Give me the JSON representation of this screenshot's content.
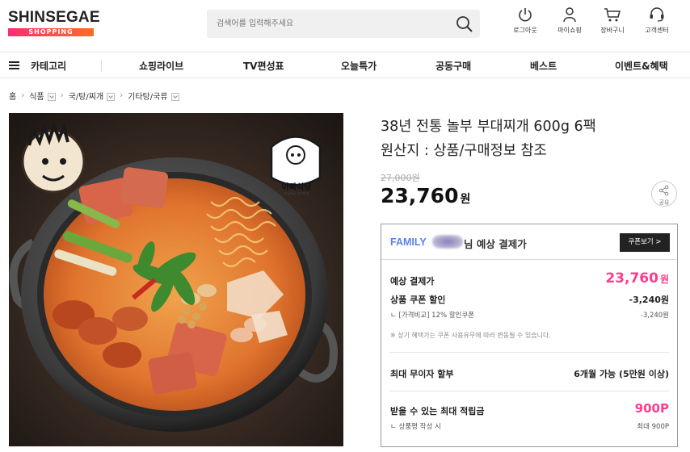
{
  "header": {
    "logo_top": "SHINSEGAE",
    "logo_bottom": "SHOPPING",
    "search_placeholder": "검색어를 입력해주세요",
    "utils": [
      {
        "label": "로그아웃",
        "icon": "power-icon"
      },
      {
        "label": "마이쇼핑",
        "icon": "user-icon"
      },
      {
        "label": "장바구니",
        "icon": "cart-icon"
      },
      {
        "label": "고객센터",
        "icon": "headset-icon"
      }
    ]
  },
  "nav": {
    "category": "카테고리",
    "items": [
      "쇼핑라이브",
      "TV편성표",
      "오늘특가",
      "공동구매",
      "베스트",
      "이벤트&혜택"
    ]
  },
  "breadcrumb": [
    "홈",
    "식품",
    "국/탕/찌개",
    "기타탕/국류"
  ],
  "image": {
    "badge_main": "아빠식당",
    "badge_sub": "보글보글 부대찌개"
  },
  "product": {
    "title_line1": "38년 전통 놀부 부대찌개 600g 6팩",
    "title_line2": "원산지 : 상품/구매정보 참조",
    "original_price": "27,000원",
    "price": "23,760",
    "price_unit": "원",
    "share_label": "공유"
  },
  "benefit": {
    "family_label": "FAMILY",
    "nim_suffix": "님 예상 결제가",
    "coupon_button": "쿠폰보기 >",
    "expected_label": "예상 결제가",
    "expected_value": "23,760",
    "expected_unit": "원",
    "coupon_label": "상품 쿠폰 할인",
    "coupon_value": "-3,240원",
    "coupon_detail_label": "ㄴ [가격비교] 12% 할인쿠폰",
    "coupon_detail_value": "-3,240원",
    "note": "※ 상기 혜택가는 쿠폰 사용유무에 따라 변동될 수 있습니다.",
    "installment_label": "최대 무이자 할부",
    "installment_value": "6개월 가능 (5만원 이상)",
    "points_label": "받을 수 있는 최대 적립금",
    "points_value": "900P",
    "points_detail_label": "ㄴ 상품평 작성 시",
    "points_detail_value": "최대 900P"
  }
}
